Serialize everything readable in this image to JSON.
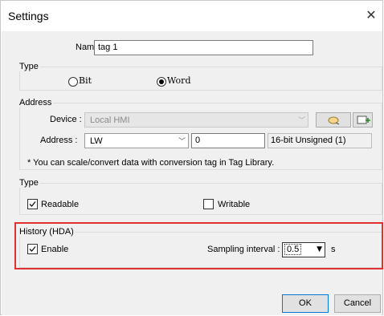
{
  "dialog": {
    "title": "Settings"
  },
  "name_field": {
    "label": "Name :",
    "value": "tag 1"
  },
  "type_group": {
    "legend": "Type",
    "options": [
      {
        "label": "Bit",
        "selected": false
      },
      {
        "label": "Word",
        "selected": true
      }
    ]
  },
  "address_group": {
    "legend": "Address",
    "device_label": "Device :",
    "device_value": "Local HMI",
    "address_label": "Address :",
    "address_type": "LW",
    "address_value": "0",
    "data_format": "16-bit Unsigned (1)",
    "note": "* You can scale/convert data with conversion tag in Tag Library."
  },
  "access_group": {
    "legend": "Type",
    "readable": {
      "label": "Readable",
      "checked": true
    },
    "writable": {
      "label": "Writable",
      "checked": false
    }
  },
  "history_group": {
    "legend": "History (HDA)",
    "enable": {
      "label": "Enable",
      "checked": true
    },
    "interval_label": "Sampling interval :",
    "interval_value": "0.5",
    "interval_unit": "s",
    "highlight_color": "#e03030"
  },
  "buttons": {
    "ok": "OK",
    "cancel": "Cancel"
  }
}
